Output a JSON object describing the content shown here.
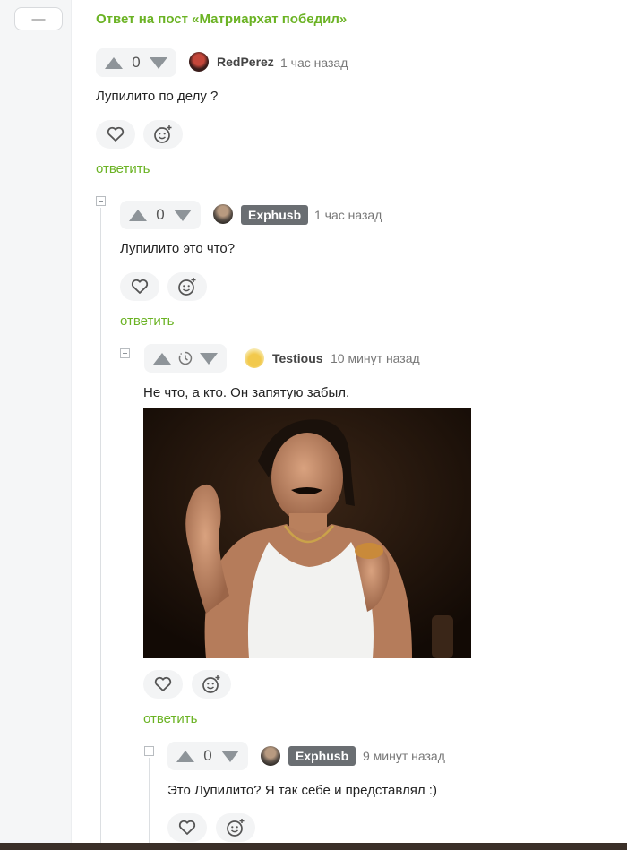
{
  "sidebar": {
    "collapse_label": "—"
  },
  "post_link": "Ответ на пост «Матриархат победил»",
  "comments": [
    {
      "score": "0",
      "author": "RedPerez",
      "time": "1 час назад",
      "text": "Лупилито по делу ?",
      "reply": "ответить",
      "badge": false
    },
    {
      "score": "0",
      "author": "Exphusb",
      "time": "1 час назад",
      "text": "Лупилито это что?",
      "reply": "ответить",
      "badge": true
    },
    {
      "score": "",
      "author": "Testious",
      "time": "10 минут назад",
      "text": "Не что, а кто. Он запятую забыл.",
      "reply": "ответить",
      "badge": false,
      "rating_pending": true,
      "has_image": true
    },
    {
      "score": "0",
      "author": "Exphusb",
      "time": "9 минут назад",
      "text": "Это Лупилито? Я так себе и представлял :)",
      "reply": "",
      "badge": true
    }
  ],
  "icons": {
    "upvote": "arrow-up-icon",
    "downvote": "arrow-down-icon",
    "like": "heart-icon",
    "react": "smiley-plus-icon",
    "pending": "clock-icon"
  },
  "colors": {
    "accent": "#6bb324",
    "badge": "#6a6e72",
    "icon": "#8e9499"
  }
}
